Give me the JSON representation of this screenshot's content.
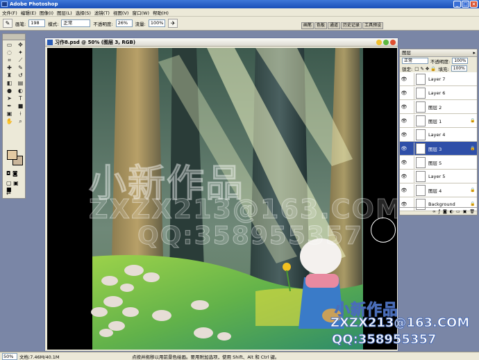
{
  "app": {
    "title": "Adobe Photoshop"
  },
  "window_buttons": [
    "_",
    "□",
    "×"
  ],
  "menu": [
    "文件(F)",
    "编辑(E)",
    "图像(I)",
    "图层(L)",
    "选择(S)",
    "滤镜(T)",
    "视图(V)",
    "窗口(W)",
    "帮助(H)"
  ],
  "options": {
    "brush_label": "画笔:",
    "brush_size": "198",
    "mode_label": "模式:",
    "mode_value": "正常",
    "opacity_label": "不透明度:",
    "opacity_value": "26%",
    "flow_label": "流量:",
    "flow_value": "100%"
  },
  "palette_well": [
    "画笔",
    "色板",
    "通道",
    "历史记录",
    "工具预设"
  ],
  "document": {
    "title": "习作8.psd @ 50% (图层 3, RGB)"
  },
  "layers_panel": {
    "tab": "图层",
    "blend_mode": "正常",
    "opacity_label": "不透明度:",
    "opacity_value": "100%",
    "lock_label": "锁定:",
    "fill_label": "填充:",
    "fill_value": "100%",
    "layers": [
      {
        "name": "Layer 7",
        "selected": false,
        "locked": false
      },
      {
        "name": "Layer 6",
        "selected": false,
        "locked": false
      },
      {
        "name": "图层 2",
        "selected": false,
        "locked": false
      },
      {
        "name": "图层 1",
        "selected": false,
        "locked": true
      },
      {
        "name": "Layer 4",
        "selected": false,
        "locked": false
      },
      {
        "name": "图层 3",
        "selected": true,
        "locked": true
      },
      {
        "name": "图层 5",
        "selected": false,
        "locked": false
      },
      {
        "name": "Layer 5",
        "selected": false,
        "locked": false
      },
      {
        "name": "图层 4",
        "selected": false,
        "locked": true
      },
      {
        "name": "Background",
        "selected": false,
        "locked": true
      }
    ]
  },
  "status": {
    "zoom": "50%",
    "doc_size": "文档:7.46M/40.1M",
    "hint": "点按并拖移以用前景色绘画。要用附加选项，使用 Shift、Alt 和 Ctrl 键。"
  },
  "watermark": {
    "line1": "小新作品",
    "line2": "ZXZX213@163.COM",
    "line3": "QQ:358955357"
  },
  "colors": {
    "foreground": "#e3caa3",
    "background": "#c9b59a"
  }
}
